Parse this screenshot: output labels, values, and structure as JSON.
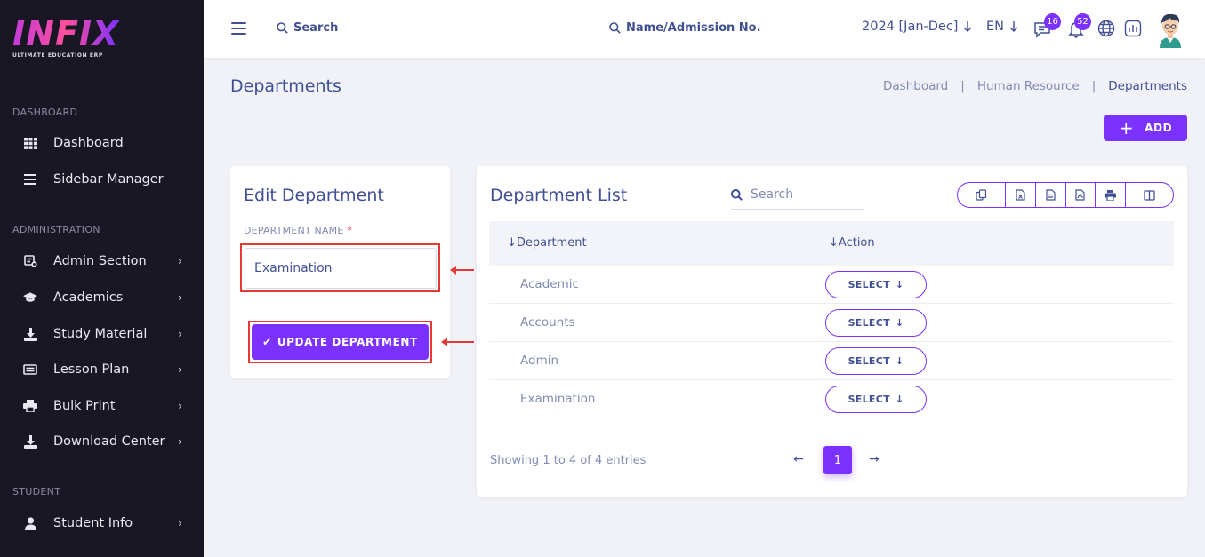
{
  "brand": {
    "logo_text": "INFIX",
    "tagline": "ULTIMATE EDUCATION ERP"
  },
  "sidebar": {
    "sections": [
      {
        "title": "DASHBOARD"
      },
      {
        "title": "ADMINISTRATION"
      },
      {
        "title": "STUDENT"
      }
    ],
    "items": [
      {
        "label": "Dashboard",
        "icon": "grid-icon"
      },
      {
        "label": "Sidebar Manager",
        "icon": "bars-icon"
      },
      {
        "label": "Admin Section",
        "icon": "admin-icon"
      },
      {
        "label": "Academics",
        "icon": "graduation-cap-icon"
      },
      {
        "label": "Study Material",
        "icon": "download-icon"
      },
      {
        "label": "Lesson Plan",
        "icon": "list-icon"
      },
      {
        "label": "Bulk Print",
        "icon": "printer-icon"
      },
      {
        "label": "Download Center",
        "icon": "download-icon"
      },
      {
        "label": "Student Info",
        "icon": "user-icon"
      }
    ]
  },
  "header": {
    "search_label": "Search",
    "student_search_label": "Name/Admission No.",
    "academic_year": "2024 [Jan-Dec]",
    "language": "EN",
    "messages_count": "16",
    "notifications_count": "52"
  },
  "page": {
    "title": "Departments",
    "breadcrumb": [
      "Dashboard",
      "Human Resource",
      "Departments"
    ],
    "add_label": "ADD"
  },
  "edit_form": {
    "title": "Edit Department",
    "field_label": "DEPARTMENT NAME",
    "required_mark": "*",
    "department_name": "Examination",
    "submit_label": "UPDATE DEPARTMENT"
  },
  "list": {
    "title": "Department List",
    "search_placeholder": "Search",
    "columns": [
      "Department",
      "Action"
    ],
    "rows": [
      {
        "name": "Academic",
        "action": "SELECT"
      },
      {
        "name": "Accounts",
        "action": "SELECT"
      },
      {
        "name": "Admin",
        "action": "SELECT"
      },
      {
        "name": "Examination",
        "action": "SELECT"
      }
    ],
    "showing_text": "Showing 1 to 4 of 4 entries",
    "current_page": "1"
  },
  "colors": {
    "accent": "#7c32ff",
    "text": "#415094",
    "muted": "#828bb2",
    "sidebar_bg": "#181723",
    "highlight": "#e53935"
  }
}
